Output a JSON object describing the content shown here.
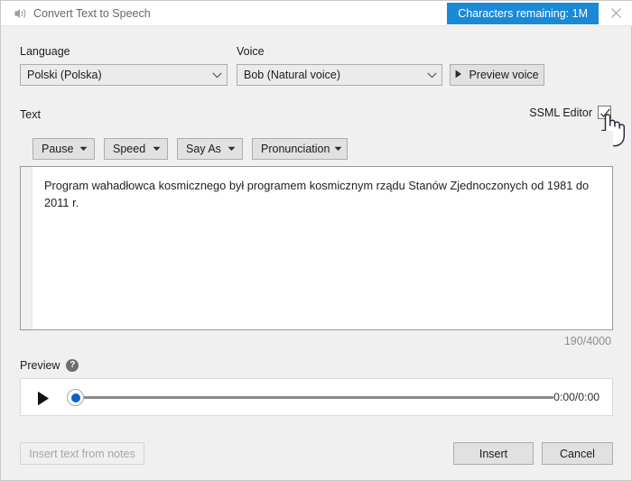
{
  "window": {
    "title": "Convert Text to Speech",
    "icon": "speech-icon",
    "chars_badge": "Characters remaining: 1M",
    "close_icon": "close-icon",
    "badge_color": "#1b8ad6"
  },
  "language": {
    "label": "Language",
    "value": "Polski (Polska)"
  },
  "voice": {
    "label": "Voice",
    "value": "Bob (Natural voice)",
    "preview_button": "Preview voice"
  },
  "text_section": {
    "label": "Text",
    "ssml_label": "SSML Editor",
    "ssml_checked": true,
    "toolbar": [
      {
        "label": "Pause"
      },
      {
        "label": "Speed"
      },
      {
        "label": "Say As"
      },
      {
        "label": "Pronunciation"
      }
    ],
    "content": "Program wahadłowca kosmicznego był programem kosmicznym rządu Stanów Zjednoczonych od 1981 do 2011 r.",
    "char_count": "190/4000"
  },
  "preview": {
    "label": "Preview",
    "help_glyph": "?",
    "play_icon": "play-icon",
    "time": "0:00/0:00",
    "progress_percent": 0
  },
  "footer": {
    "insert_from_notes": "Insert text from notes",
    "insert_from_notes_disabled": true,
    "insert": "Insert",
    "cancel": "Cancel"
  }
}
